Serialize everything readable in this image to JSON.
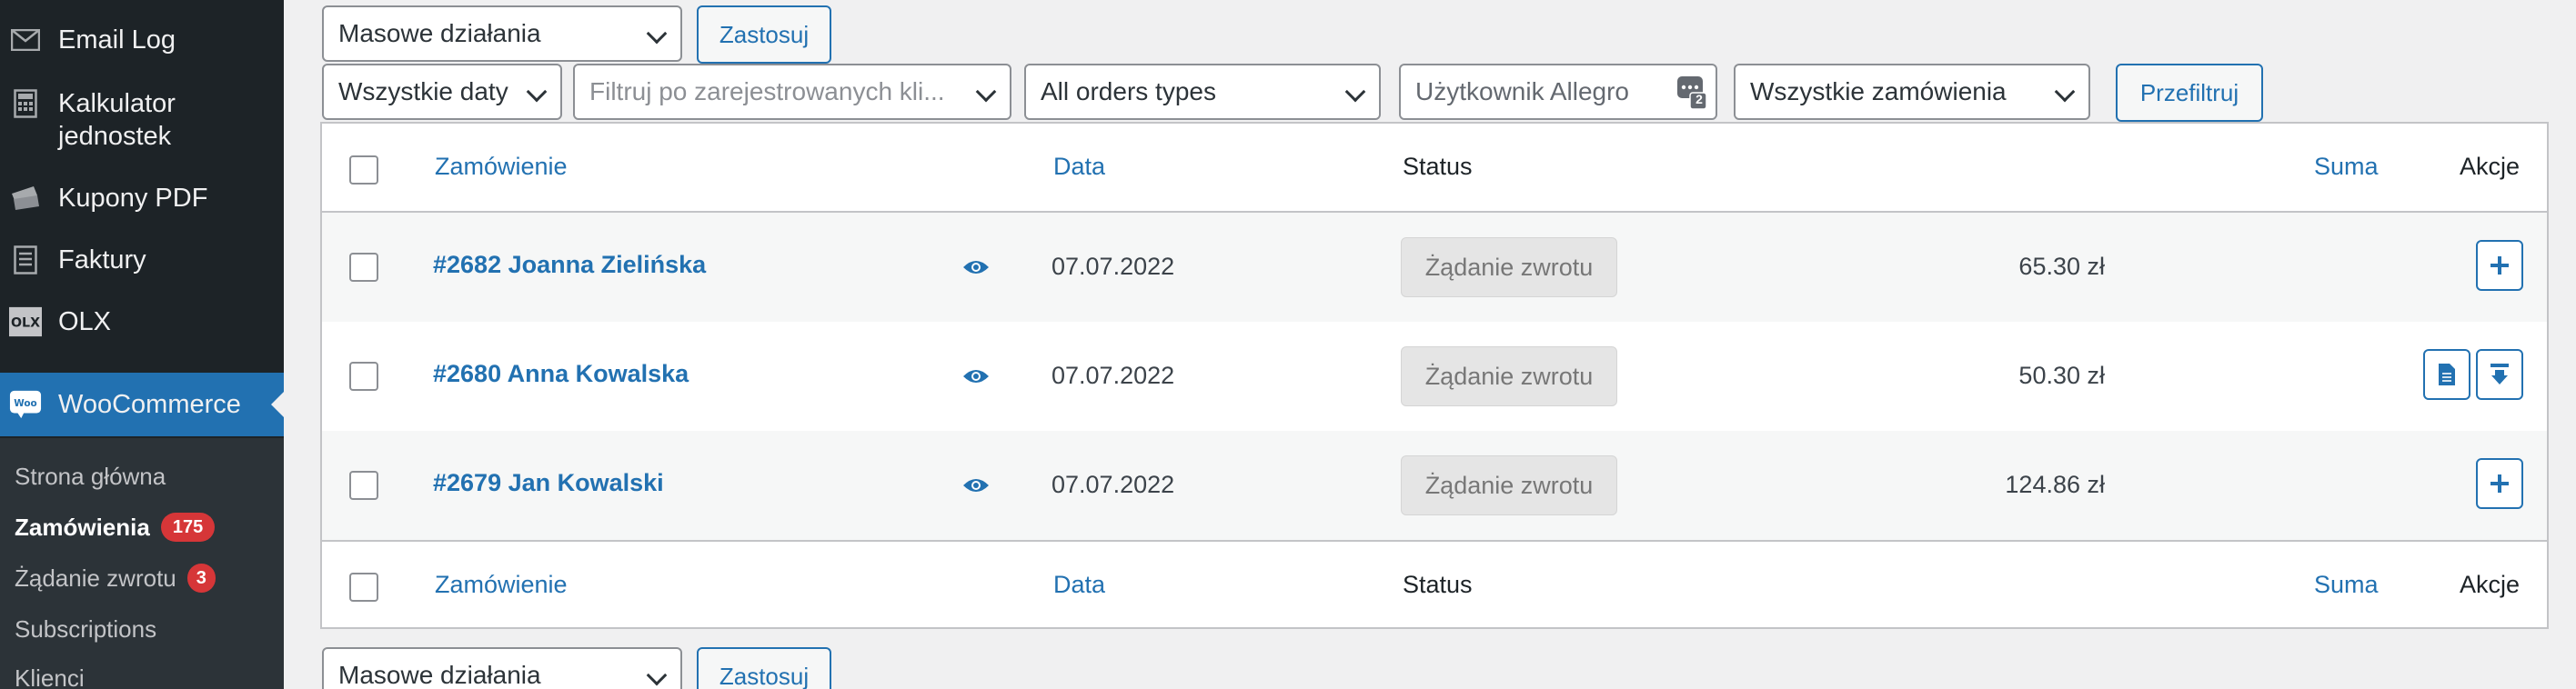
{
  "sidebar": {
    "items": [
      {
        "label": "Email Log",
        "icon": "envelope-icon"
      },
      {
        "label": "Kalkulator jednostek",
        "icon": "calculator-icon"
      },
      {
        "label": "Kupony PDF",
        "icon": "tickets-icon"
      },
      {
        "label": "Faktury",
        "icon": "invoice-icon"
      },
      {
        "label": "OLX",
        "icon": "olx-logo-icon"
      },
      {
        "label": "WooCommerce",
        "icon": "woocommerce-icon"
      }
    ],
    "submenu": [
      {
        "label": "Strona główna"
      },
      {
        "label": "Zamówienia",
        "count": "175"
      },
      {
        "label": "Żądanie zwrotu",
        "count": "3"
      },
      {
        "label": "Subscriptions"
      },
      {
        "label": "Klienci"
      }
    ]
  },
  "bulk_top": {
    "select": "Masowe działania",
    "apply": "Zastosuj"
  },
  "filters": {
    "dates": "Wszystkie daty",
    "customer_placeholder": "Filtruj po zarejestrowanych kli...",
    "order_types": "All orders types",
    "allegro_placeholder": "Użytkownik Allegro",
    "allegro_badge": "2",
    "orders_scope": "Wszystkie zamówienia",
    "filter_button": "Przefiltruj"
  },
  "table": {
    "columns": {
      "order": "Zamówienie",
      "date": "Data",
      "status": "Status",
      "total": "Suma",
      "actions": "Akcje"
    },
    "rows": [
      {
        "order": "#2682 Joanna Zielińska",
        "date": "07.07.2022",
        "status": "Żądanie zwrotu",
        "total": "65.30 zł",
        "actions": [
          "add-icon"
        ]
      },
      {
        "order": "#2680 Anna Kowalska",
        "date": "07.07.2022",
        "status": "Żądanie zwrotu",
        "total": "50.30 zł",
        "actions": [
          "invoice-icon",
          "download-icon"
        ]
      },
      {
        "order": "#2679 Jan Kowalski",
        "date": "07.07.2022",
        "status": "Żądanie zwrotu",
        "total": "124.86 zł",
        "actions": [
          "add-icon"
        ]
      }
    ]
  },
  "bulk_bottom": {
    "select": "Masowe działania",
    "apply": "Zastosuj"
  },
  "colors": {
    "accent": "#2271b1",
    "sidebar_bg": "#1d2327",
    "submenu_bg": "#2c3338",
    "badge": "#d63638"
  }
}
